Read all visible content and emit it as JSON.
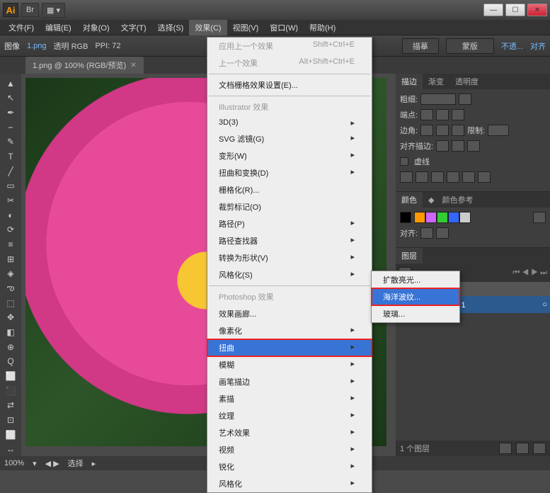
{
  "titlebar": {
    "logo": "Ai",
    "br": "Br"
  },
  "window_buttons": {
    "min": "—",
    "max": "☐",
    "close": "✕"
  },
  "menubar": [
    "文件(F)",
    "编辑(E)",
    "对象(O)",
    "文字(T)",
    "选择(S)",
    "效果(C)",
    "视图(V)",
    "窗口(W)",
    "帮助(H)"
  ],
  "menubar_active_index": 5,
  "controlbar": {
    "img_label": "图像",
    "filelink": "1.png",
    "mode": "透明 RGB",
    "ppi_label": "PPI:",
    "ppi": "72",
    "drawbrush": "描摹",
    "mask": "蒙版",
    "opacity": "不透...",
    "align": "对齐"
  },
  "doctab": {
    "title": "1.png @ 100% (RGB/预览)"
  },
  "effects_menu": {
    "top": [
      {
        "label": "应用上一个效果",
        "short": "Shift+Ctrl+E",
        "disabled": true
      },
      {
        "label": "上一个效果",
        "short": "Alt+Shift+Ctrl+E",
        "disabled": true
      }
    ],
    "doc_raster": {
      "label": "文档栅格效果设置(E)..."
    },
    "cat1": "Illustrator 效果",
    "ill": [
      {
        "label": "3D(3)",
        "sub": true
      },
      {
        "label": "SVG 滤镜(G)",
        "sub": true
      },
      {
        "label": "变形(W)",
        "sub": true
      },
      {
        "label": "扭曲和变换(D)",
        "sub": true
      },
      {
        "label": "栅格化(R)..."
      },
      {
        "label": "裁剪标记(O)"
      },
      {
        "label": "路径(P)",
        "sub": true
      },
      {
        "label": "路径查找器",
        "sub": true
      },
      {
        "label": "转换为形状(V)",
        "sub": true
      },
      {
        "label": "风格化(S)",
        "sub": true
      }
    ],
    "cat2": "Photoshop 效果",
    "ps": [
      {
        "label": "效果画廊..."
      },
      {
        "label": "像素化",
        "sub": true
      },
      {
        "label": "扭曲",
        "sub": true,
        "hl": true
      },
      {
        "label": "模糊",
        "sub": true
      },
      {
        "label": "画笔描边",
        "sub": true
      },
      {
        "label": "素描",
        "sub": true
      },
      {
        "label": "纹理",
        "sub": true
      },
      {
        "label": "艺术效果",
        "sub": true
      },
      {
        "label": "视频",
        "sub": true
      },
      {
        "label": "锐化",
        "sub": true
      },
      {
        "label": "风格化",
        "sub": true
      }
    ]
  },
  "submenu": [
    "扩散亮光...",
    "海洋波纹...",
    "玻璃..."
  ],
  "submenu_hl_index": 1,
  "panels": {
    "stroke": {
      "tabs": [
        "描边",
        "渐变",
        "透明度"
      ],
      "weight_label": "粗细:",
      "cap_label": "端点:",
      "corner_label": "边角:",
      "limit_label": "限制:",
      "limit_val": "",
      "align_label": "对齐描边:",
      "dash": "虚线"
    },
    "color": {
      "tabs": [
        "颜色",
        "颜色参考"
      ],
      "align_label": "对齐:"
    },
    "layers": {
      "tabs": [
        "图层"
      ],
      "layer_name": "图层 1",
      "count": "1 个图层"
    }
  },
  "statusbar": {
    "zoom": "100%",
    "tool_label": "选择"
  },
  "tool_icons": [
    "▲",
    "↖",
    "✒",
    "⎯",
    "✎",
    "T",
    "╱",
    "▭",
    "✂",
    "◐",
    "⟳",
    "≡",
    "⊞",
    "◈",
    "ఌ",
    "⬚",
    "✥",
    "◧",
    "⊕",
    "Q",
    "⬜",
    "⬛",
    "⇄",
    "⊡",
    "⬜",
    "↔"
  ],
  "swatch_colors": [
    "#ff9900",
    "#cc66ff",
    "#33cc33",
    "#3366ff",
    "#cccccc"
  ]
}
